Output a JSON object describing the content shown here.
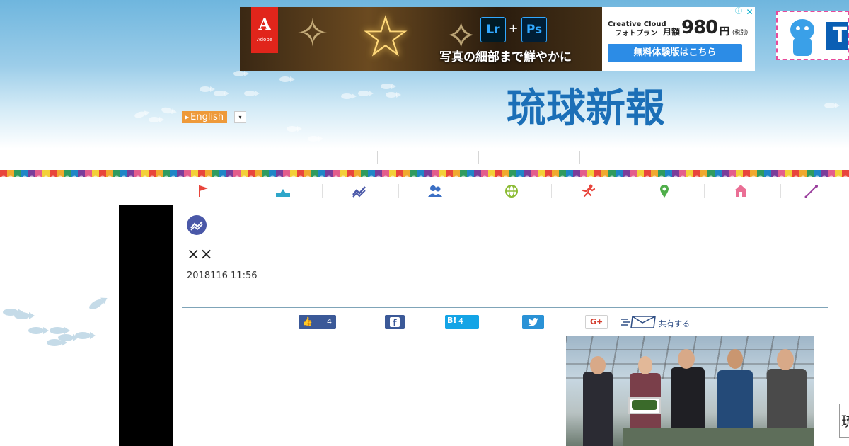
{
  "ad": {
    "brand": "Adobe",
    "app1": "Lr",
    "app2": "Ps",
    "plus": "+",
    "tagline": "写真の細部まで鮮やかに",
    "cc_line1": "Creative Cloud",
    "cc_line2": "フォトプラン",
    "price_label": "月額",
    "price": "980",
    "yen": "円",
    "tax": "(税別)",
    "cta": "無料体験版はこちら",
    "info": "ⓘ",
    "close": "✕"
  },
  "header": {
    "lang_label": "English",
    "lang_dropdown": "▾",
    "logo": "琉球新報"
  },
  "categories": [
    {
      "name": "flag",
      "color": "#e8453c"
    },
    {
      "name": "city",
      "color": "#2ea6c9"
    },
    {
      "name": "chart",
      "color": "#4a58a8"
    },
    {
      "name": "people",
      "color": "#3b6fc4"
    },
    {
      "name": "globe",
      "color": "#8cbc35"
    },
    {
      "name": "runner",
      "color": "#e8453c"
    },
    {
      "name": "pin",
      "color": "#4fae4a"
    },
    {
      "name": "house",
      "color": "#ea6f95"
    },
    {
      "name": "pen",
      "color": "#9a3e9d"
    }
  ],
  "article": {
    "title": "××",
    "date": "2018116 11:56"
  },
  "share": {
    "like_count": "4",
    "hatena_label": "B!",
    "hatena_count": "4",
    "fb_label": "f",
    "tw_label": "🐦",
    "gplus_label": "G+",
    "mail_label": "共有する"
  },
  "edge_tab": "琉",
  "colors": {
    "brand_blue": "#1b6fb7",
    "lang_orange": "#ee9a3a",
    "facebook": "#3b5998",
    "hatena": "#14a4e6",
    "twitter": "#2a92d6"
  }
}
